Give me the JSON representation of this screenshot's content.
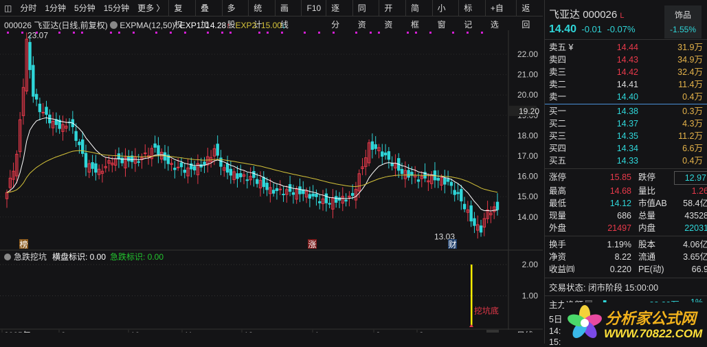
{
  "toolbar": {
    "left": [
      "分时",
      "1分钟",
      "5分钟",
      "15分钟",
      "更多 〉"
    ],
    "right": [
      "复权",
      "叠加",
      "多股",
      "统计",
      "画线",
      "F10",
      "逐分",
      "同资",
      "开资",
      "简框",
      "小窗",
      "标记",
      "+自选",
      "返回"
    ]
  },
  "info": {
    "code": "000026",
    "name": "飞亚达",
    "mode": "(日线,前复权)",
    "indicator": "EXPMA(12,50)",
    "exp1_label": "EXP1: 14.28",
    "exp2_label": "EXP2: 15.00"
  },
  "colors": {
    "up": "#e8394a",
    "down": "#2fd6d9",
    "exp1": "#ffffff",
    "exp2": "#d6c43a",
    "accent": "#2fd6d9"
  },
  "chart_data": {
    "type": "candlestick",
    "count": 150,
    "price_axis": [
      "22.00",
      "21.00",
      "20.00",
      "19.00",
      "18.00",
      "17.00",
      "16.00",
      "15.00",
      "14.00"
    ],
    "current_price_tag": "19.20",
    "high_label": "23.07",
    "low_label": "13.03",
    "keypoints": [
      [
        0,
        15.2
      ],
      [
        3,
        17
      ],
      [
        5,
        20.5
      ],
      [
        6,
        22.6
      ],
      [
        8,
        20
      ],
      [
        10,
        19.3
      ],
      [
        14,
        18.6
      ],
      [
        17,
        18.4
      ],
      [
        19,
        18.7
      ],
      [
        22,
        17.5
      ],
      [
        24,
        16.6
      ],
      [
        28,
        16.2
      ],
      [
        32,
        16.8
      ],
      [
        40,
        16.8
      ],
      [
        45,
        17.4
      ],
      [
        50,
        16.5
      ],
      [
        55,
        16.3
      ],
      [
        60,
        16.6
      ],
      [
        63,
        17.3
      ],
      [
        66,
        16.3
      ],
      [
        70,
        16
      ],
      [
        75,
        15.9
      ],
      [
        80,
        15.3
      ],
      [
        90,
        15.2
      ],
      [
        97,
        14.7
      ],
      [
        105,
        15.0
      ],
      [
        110,
        17.5
      ],
      [
        113,
        17.3
      ],
      [
        116,
        16.8
      ],
      [
        120,
        16.2
      ],
      [
        125,
        15.9
      ],
      [
        130,
        15.9
      ],
      [
        134,
        15.7
      ],
      [
        138,
        14.8
      ],
      [
        142,
        13.6
      ],
      [
        144,
        13.4
      ],
      [
        146,
        14.3
      ],
      [
        149,
        14.4
      ]
    ],
    "months": [
      "2025年",
      "9",
      "10",
      "11",
      "12",
      "1",
      "2",
      "3"
    ],
    "period": "日线",
    "markers": [
      "榜",
      "涨",
      "财"
    ]
  },
  "sub": {
    "title": "急跌挖坑",
    "l1": "横盘标识: 0.00",
    "l2": "急跌标识: 0.00",
    "axis": [
      "2.00",
      "1.00"
    ],
    "signal": "挖坑底",
    "signal_value": 2
  },
  "quote": {
    "name": "飞亚达",
    "code": "000026",
    "flag": "L",
    "price": "14.40",
    "change": "-0.01",
    "pct": "-0.07%",
    "sector": "饰品",
    "sector_pct": "-1.55%",
    "asks": [
      {
        "l": "卖五 ¥",
        "p": "14.44",
        "v": "31.9万",
        "c": "red"
      },
      {
        "l": "卖四",
        "p": "14.43",
        "v": "34.9万",
        "c": "red"
      },
      {
        "l": "卖三",
        "p": "14.42",
        "v": "32.4万",
        "c": "red"
      },
      {
        "l": "卖二",
        "p": "14.41",
        "v": "11.4万",
        "c": "wh"
      },
      {
        "l": "卖一",
        "p": "14.40",
        "v": "0.4万",
        "c": "cy"
      }
    ],
    "bids": [
      {
        "l": "买一",
        "p": "14.38",
        "v": "0.3万",
        "c": "cy"
      },
      {
        "l": "买二",
        "p": "14.37",
        "v": "4.3万",
        "c": "cy"
      },
      {
        "l": "买三",
        "p": "14.35",
        "v": "11.2万",
        "c": "cy"
      },
      {
        "l": "买四",
        "p": "14.34",
        "v": "6.6万",
        "c": "cy"
      },
      {
        "l": "买五",
        "p": "14.33",
        "v": "0.4万",
        "c": "cy"
      }
    ],
    "stats": [
      [
        "涨停",
        "15.85",
        "red",
        "跌停",
        "12.97",
        "cy"
      ],
      [
        "最高",
        "14.68",
        "red",
        "量比",
        "1.26",
        "red"
      ],
      [
        "最低",
        "14.12",
        "cy",
        "市值AB",
        "58.4亿",
        "wh"
      ],
      [
        "现量",
        "686",
        "wh",
        "总量",
        "43528",
        "wh"
      ],
      [
        "外盘",
        "21497",
        "red",
        "内盘",
        "22031",
        "cy"
      ]
    ],
    "stats2": [
      [
        "换手",
        "1.19%",
        "股本",
        "4.06亿"
      ],
      [
        "净资",
        "8.22",
        "流通",
        "3.65亿"
      ],
      [
        "收益㈣",
        "0.220",
        "PE(动)",
        "66.9"
      ]
    ],
    "status": "交易状态: 闭市阶段 15:00:00",
    "flow_label": "主力净额",
    "flow_value": "-88.23万",
    "flow_pct": "-1%",
    "row5": "5日",
    "t1": "14:",
    "t2": "15:"
  },
  "logo": {
    "text": "分析家公式网",
    "url": "WWW.70822.COM"
  }
}
